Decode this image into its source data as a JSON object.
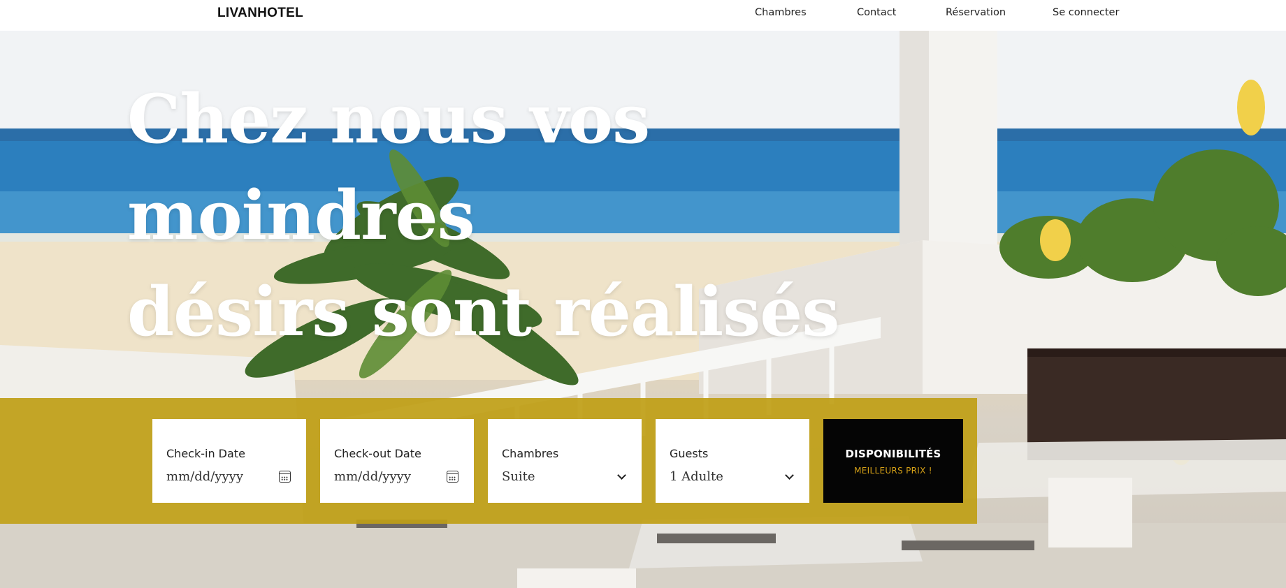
{
  "brand": {
    "name": "LIVANHOTEL"
  },
  "nav": {
    "items": [
      {
        "label": "Chambres"
      },
      {
        "label": "Contact"
      },
      {
        "label": "Réservation"
      },
      {
        "label": "Se connecter"
      }
    ]
  },
  "hero": {
    "headline_line1": "Chez nous vos moindres",
    "headline_line2": "désirs sont réalisés",
    "background_icon": "beach-terrace-photo"
  },
  "booking": {
    "checkin": {
      "label": "Check-in Date",
      "placeholder": "mm/dd/yyyy",
      "icon": "calendar-icon"
    },
    "checkout": {
      "label": "Check-out Date",
      "placeholder": "mm/dd/yyyy",
      "icon": "calendar-icon"
    },
    "rooms": {
      "label": "Chambres",
      "selected": "Suite",
      "icon": "chevron-down-icon"
    },
    "guests": {
      "label": "Guests",
      "selected": "1 Adulte",
      "icon": "chevron-down-icon"
    },
    "cta": {
      "label": "DISPONIBILITÉS",
      "sublabel": "MEILLEURS PRIX !"
    }
  },
  "colors": {
    "booking_bar": "#bf9f17",
    "cta_background": "#050505",
    "cta_sublabel": "#d4a017",
    "headline": "#ffffff",
    "nav_text": "#222222"
  }
}
